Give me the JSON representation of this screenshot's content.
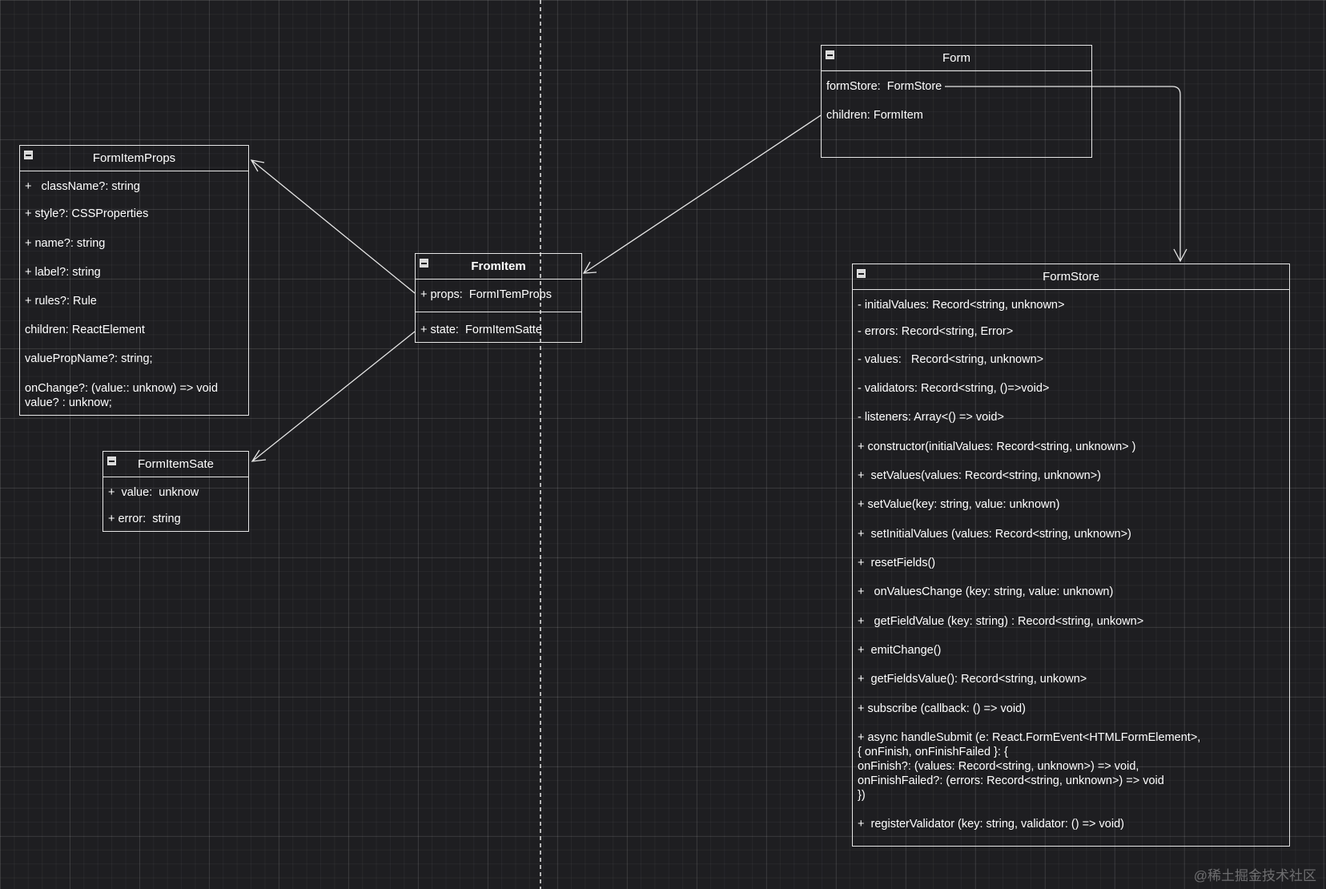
{
  "diagram": {
    "classes": {
      "form": {
        "title": "Form",
        "fields": [
          "formStore:  FormStore",
          "children: FormItem"
        ]
      },
      "formItemProps": {
        "title": "FormItemProps",
        "fields": [
          "+   className?: string",
          "+ style?: CSSProperties",
          "+ name?: string",
          "+ label?: string",
          "+ rules?: Rule",
          "children: ReactElement",
          "valuePropName?: string;",
          "onChange?: (value:: unknow) => void",
          "value? : unknow;"
        ]
      },
      "formItem": {
        "title": "FromItem",
        "props": "+ props:  FormITemProps",
        "state": "+ state:  FormItemSatte"
      },
      "formItemSate": {
        "title": "FormItemSate",
        "fields": [
          "+  value:  unknow",
          "+ error:  string"
        ]
      },
      "formStore": {
        "title": "FormStore",
        "fields": [
          "- initialValues: Record<string, unknown>",
          "- errors: Record<string, Error>",
          "- values:   Record<string, unknown>",
          "- validators: Record<string, ()=>void>",
          "- listeners: Array<() => void>",
          "+ constructor(initialValues: Record<string, unknown> )",
          "+  setValues(values: Record<string, unknown>)",
          "+ setValue(key: string, value: unknown)",
          "+  setInitialValues (values: Record<string, unknown>)",
          "+  resetFields()",
          "+   onValuesChange (key: string, value: unknown)",
          "+   getFieldValue (key: string) : Record<string, unkown>",
          "+  emitChange()",
          "+  getFieldsValue(): Record<string, unkown>",
          "+ subscribe (callback: () => void)",
          "+ async handleSubmit (e: React.FormEvent<HTMLFormElement>,",
          "{ onFinish, onFinishFailed }: {",
          "onFinish?: (values: Record<string, unknown>) => void,",
          "onFinishFailed?: (errors: Record<string, unknown>) => void",
          "})",
          "+  registerValidator (key: string, validator: () => void)"
        ]
      }
    }
  },
  "watermark": "@稀土掘金技术社区"
}
